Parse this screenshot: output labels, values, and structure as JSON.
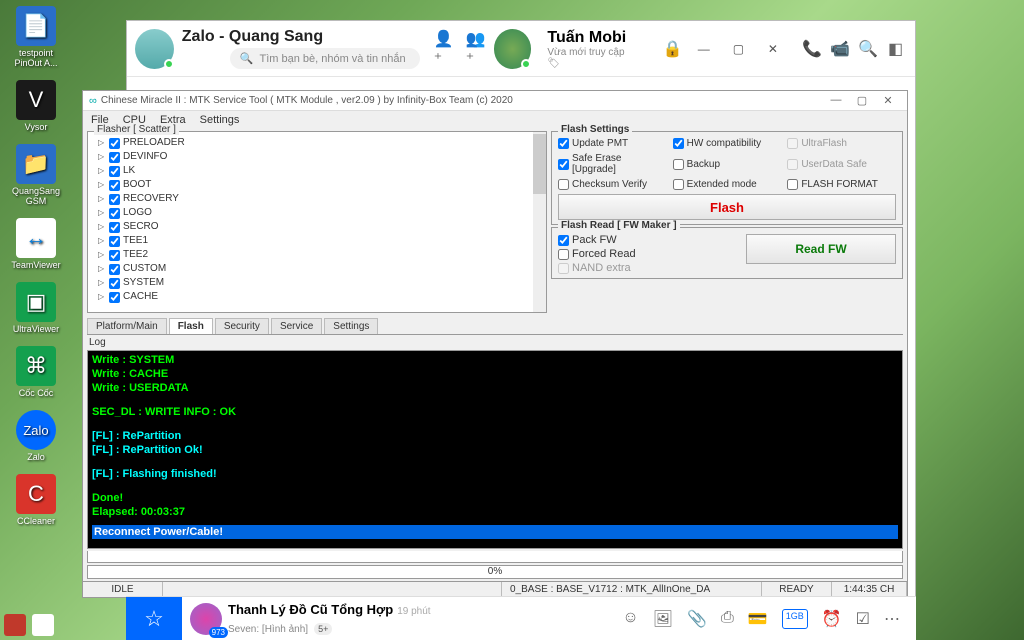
{
  "desktop": {
    "icons": [
      {
        "label": "testpoint PinOut A...",
        "bg": "#2a6ec9"
      },
      {
        "label": "Vysor",
        "bg": "#1a1a1a"
      },
      {
        "label": "QuangSang GSM",
        "bg": "#2a6ec9"
      },
      {
        "label": "TeamViewer",
        "bg": "#0e7fd8"
      },
      {
        "label": "UltraViewer",
        "bg": "#14a04e"
      },
      {
        "label": "Cốc Cốc",
        "bg": "#14a04e"
      },
      {
        "label": "Zalo",
        "bg": "#0068ff"
      },
      {
        "label": "CCleaner",
        "bg": "#d9342b"
      }
    ]
  },
  "zalo": {
    "self_name": "Zalo - Quang Sang",
    "search_placeholder": "Tìm bạn bè, nhóm và tin nhắn",
    "contact_name": "Tuấn Mobi",
    "contact_access": "Vừa mới truy cập",
    "bottom": {
      "title": "Thanh Lý Đồ Cũ Tổng Hợp",
      "time": "19 phút",
      "sub": "Seven: [Hình ảnh]",
      "badge": "973",
      "count": "5+",
      "gb": "1GB"
    }
  },
  "cm": {
    "title": "Chinese Miracle II : MTK Service Tool ( MTK Module , ver2.09  ) by Infinity-Box Team (c) 2020",
    "menu": [
      "File",
      "CPU",
      "Extra",
      "Settings"
    ],
    "flasher_label": "Flasher [ Scatter ]",
    "scatter": [
      "PRELOADER",
      "DEVINFO",
      "LK",
      "BOOT",
      "RECOVERY",
      "LOGO",
      "SECRO",
      "TEE1",
      "TEE2",
      "CUSTOM",
      "SYSTEM",
      "CACHE"
    ],
    "flash_settings": {
      "label": "Flash Settings",
      "update_pmt": "Update PMT",
      "hw_compat": "HW compatibility",
      "ultraflash": "UltraFlash",
      "safe_erase": "Safe Erase [Upgrade]",
      "backup": "Backup",
      "userdata_safe": "UserData Safe",
      "checksum": "Checksum Verify",
      "extended": "Extended mode",
      "flash_format": "FLASH FORMAT",
      "flash_btn": "Flash"
    },
    "flash_read": {
      "label": "Flash Read [ FW Maker ]",
      "pack_fw": "Pack FW",
      "forced": "Forced Read",
      "nand": "NAND extra",
      "read_btn": "Read FW"
    },
    "tabs": [
      "Platform/Main",
      "Flash",
      "Security",
      "Service",
      "Settings"
    ],
    "log_label": "Log",
    "console": {
      "l1": "Write : SYSTEM",
      "l2": "Write : CACHE",
      "l3": "Write : USERDATA",
      "l4": "SEC_DL : WRITE INFO : OK",
      "l5": "[FL] : RePartition",
      "l6": "[FL] : RePartition Ok!",
      "l7": "[FL] : Flashing finished!",
      "l8": "Done!",
      "l9": "Elapsed: 00:03:37",
      "l10": "Reconnect Power/Cable!"
    },
    "progress": "0%",
    "status": {
      "idle": "IDLE",
      "base": "0_BASE : BASE_V1712 : MTK_AllInOne_DA",
      "ready": "READY",
      "time": "1:44:35 CH"
    }
  }
}
